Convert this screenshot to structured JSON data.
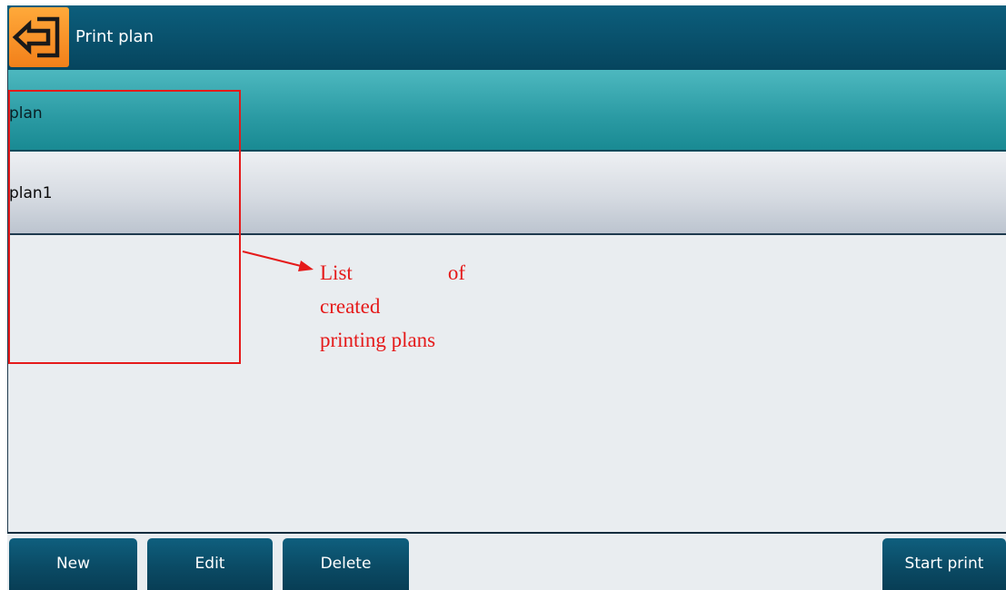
{
  "titlebar": {
    "title": "Print plan",
    "back_icon": "exit-arrow-icon"
  },
  "list": {
    "header": "plan",
    "rows": [
      {
        "label": "plan1"
      }
    ]
  },
  "toolbar": {
    "new_label": "New",
    "edit_label": "Edit",
    "delete_label": "Delete",
    "start_print_label": "Start print"
  },
  "annotation": {
    "word1": "List",
    "word2": "of",
    "line2": "created",
    "line3": "printing plans",
    "color": "#e51a1a"
  },
  "colors": {
    "titlebar": "#0a5572",
    "back_button": "#f5901f",
    "header": "#2a9aa3",
    "button": "#0b4d68"
  }
}
